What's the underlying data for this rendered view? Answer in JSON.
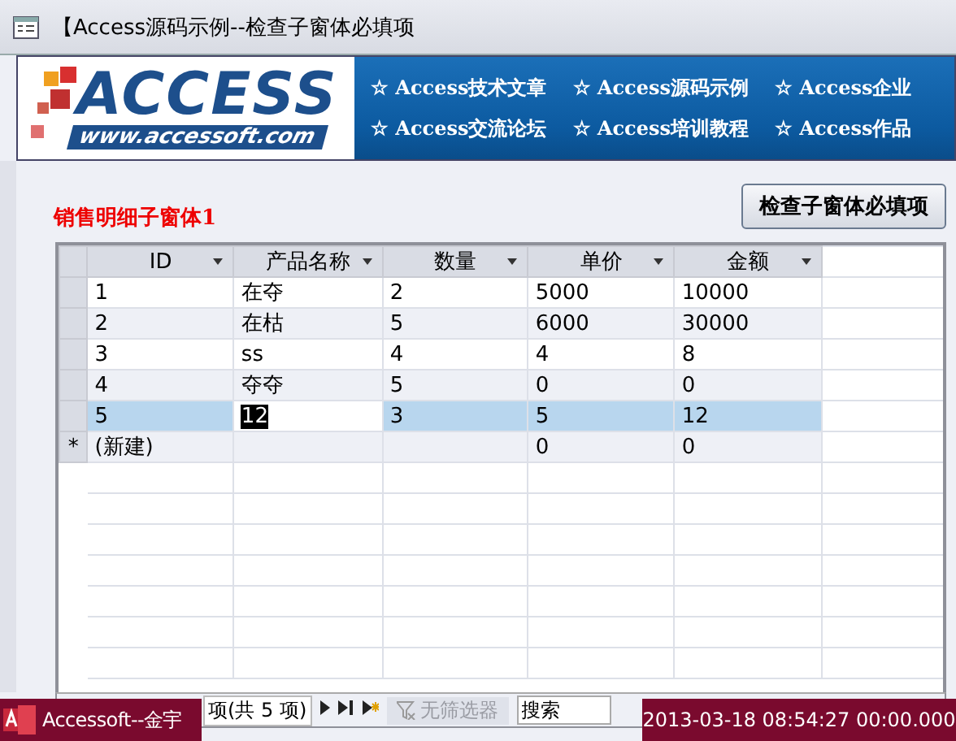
{
  "window": {
    "title": "【Access源码示例--检查子窗体必填项"
  },
  "banner": {
    "logo_title": "ACCESS",
    "logo_url": "www.accessoft.com",
    "links": [
      "☆ Access技术文章",
      "☆ Access源码示例",
      "☆ Access企业",
      "☆ Access交流论坛",
      "☆ Access培训教程",
      "☆ Access作品"
    ]
  },
  "subform_label": "销售明细子窗体1",
  "check_button": "检查子窗体必填项",
  "datasheet": {
    "columns": [
      "ID",
      "产品名称",
      "数量",
      "单价",
      "金额"
    ],
    "rows": [
      {
        "kind": "record",
        "selected": false,
        "cells": [
          {
            "text": "1",
            "selected": false
          },
          {
            "text": "在夺",
            "selected": false
          },
          {
            "text": "2",
            "selected": false
          },
          {
            "text": "5000",
            "selected": false
          },
          {
            "text": "10000",
            "selected": false
          }
        ]
      },
      {
        "kind": "record",
        "selected": false,
        "cells": [
          {
            "text": "2",
            "selected": false
          },
          {
            "text": "在枯",
            "selected": false
          },
          {
            "text": "5",
            "selected": false
          },
          {
            "text": "6000",
            "selected": false
          },
          {
            "text": "30000",
            "selected": false
          }
        ]
      },
      {
        "kind": "record",
        "selected": false,
        "cells": [
          {
            "text": "3",
            "selected": false
          },
          {
            "text": "ss",
            "selected": false
          },
          {
            "text": "4",
            "selected": false
          },
          {
            "text": "4",
            "selected": false
          },
          {
            "text": "8",
            "selected": false
          }
        ]
      },
      {
        "kind": "record",
        "selected": false,
        "cells": [
          {
            "text": "4",
            "selected": false
          },
          {
            "text": "夺夺",
            "selected": false
          },
          {
            "text": "5",
            "selected": false
          },
          {
            "text": "0",
            "selected": false
          },
          {
            "text": "0",
            "selected": false
          }
        ]
      },
      {
        "kind": "record",
        "selected": true,
        "cells": [
          {
            "text": "5",
            "selected": false
          },
          {
            "text": "12",
            "selected": true
          },
          {
            "text": "3",
            "selected": false
          },
          {
            "text": "5",
            "selected": false
          },
          {
            "text": "12",
            "selected": false
          }
        ]
      },
      {
        "kind": "new",
        "marker": "*",
        "selected": false,
        "cells": [
          {
            "text": "(新建)",
            "selected": false
          },
          {
            "text": "",
            "selected": false
          },
          {
            "text": "",
            "selected": false
          },
          {
            "text": "0",
            "selected": false
          },
          {
            "text": "0",
            "selected": false
          }
        ]
      }
    ]
  },
  "navigation": {
    "record_text": "项(共 5 项)",
    "filter": {
      "label": "无筛选器",
      "disabled": true
    },
    "search": {
      "placeholder": "搜索"
    }
  },
  "overlays": {
    "author": "Accessoft--金宇",
    "timestamp": "2013-03-18 08:54:27 00:00.000"
  }
}
